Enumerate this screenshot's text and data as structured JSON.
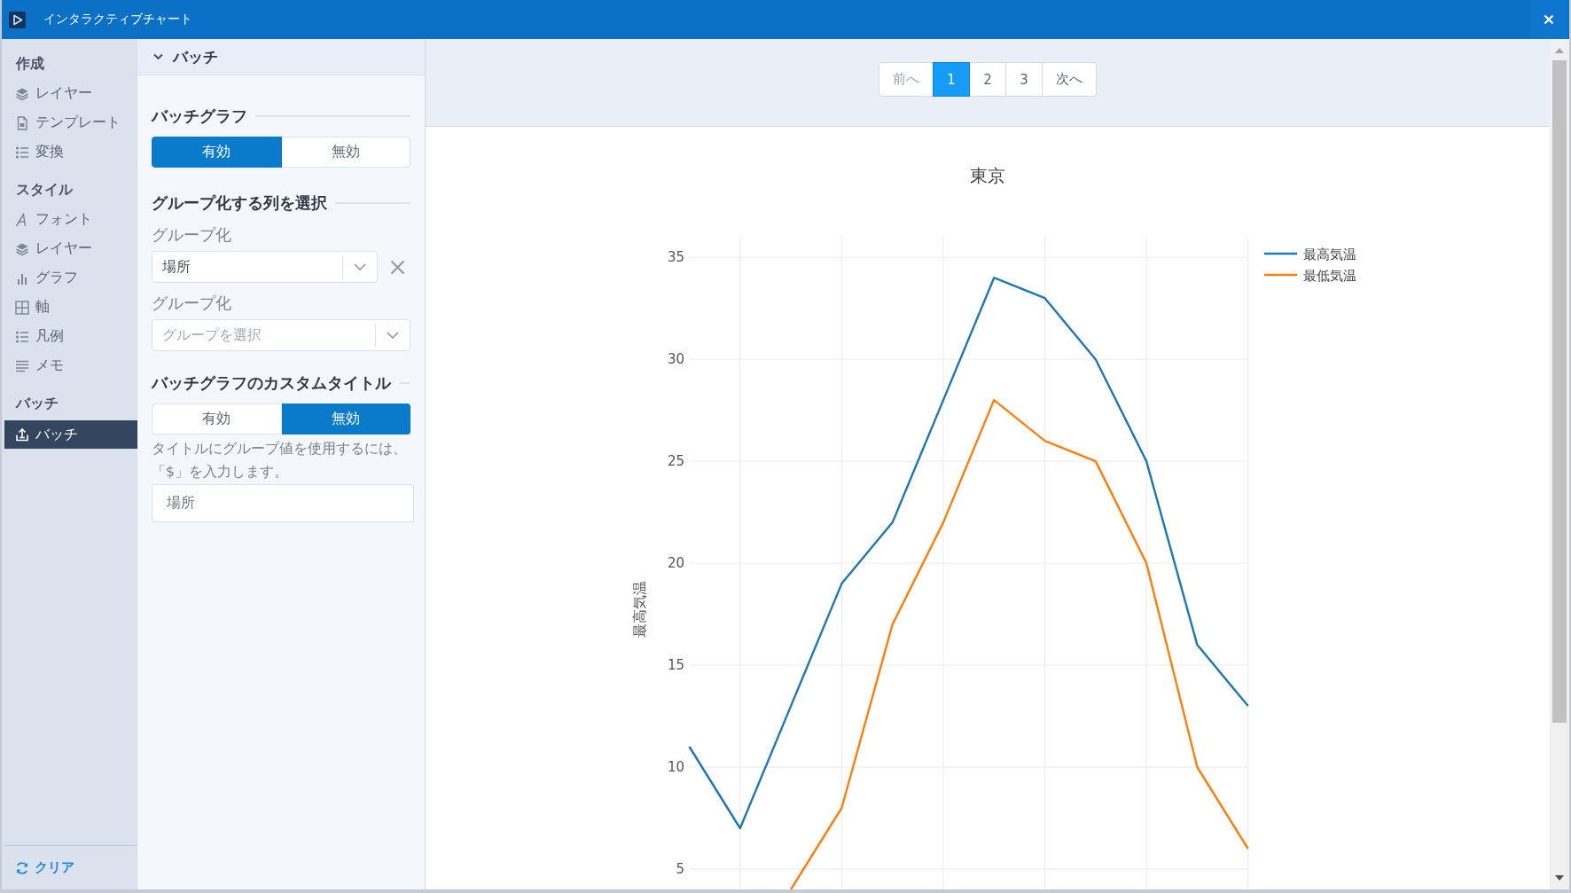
{
  "window": {
    "title": "インタラクティブチャート"
  },
  "sidebar": {
    "sections": [
      {
        "title": "作成",
        "items": [
          {
            "label": "レイヤー",
            "kind": "layer",
            "selected": false
          },
          {
            "label": "テンプレート",
            "kind": "template",
            "selected": false
          },
          {
            "label": "変換",
            "kind": "transform",
            "selected": false
          }
        ]
      },
      {
        "title": "スタイル",
        "items": [
          {
            "label": "フォント",
            "kind": "font",
            "selected": false
          },
          {
            "label": "レイヤー",
            "kind": "layer",
            "selected": false
          },
          {
            "label": "グラフ",
            "kind": "graph",
            "selected": false
          },
          {
            "label": "軸",
            "kind": "axis",
            "selected": false
          },
          {
            "label": "凡例",
            "kind": "legend",
            "selected": false
          },
          {
            "label": "メモ",
            "kind": "memo",
            "selected": false
          }
        ]
      },
      {
        "title": "バッチ",
        "items": [
          {
            "label": "バッチ",
            "kind": "batch",
            "selected": true
          }
        ]
      }
    ],
    "footer": {
      "label": "クリア"
    }
  },
  "panel": {
    "title": "バッチ",
    "expanded": true,
    "batch_graph": {
      "heading": "バッチグラフ",
      "options": [
        {
          "label": "有効",
          "selected": true
        },
        {
          "label": "無効",
          "selected": false
        }
      ]
    },
    "group_by": {
      "heading": "グループ化する列を選択",
      "fields": [
        {
          "label": "グループ化",
          "value": "場所",
          "clearable": true
        },
        {
          "label": "グループ化",
          "placeholder": "グループを選択",
          "clearable": false
        }
      ]
    },
    "custom_title": {
      "heading": "バッチグラフのカスタムタイトル",
      "options": [
        {
          "label": "有効",
          "selected": false
        },
        {
          "label": "無効",
          "selected": true
        }
      ],
      "help": "タイトルにグループ値を使用するには、「$」を入力します。",
      "value": "場所"
    }
  },
  "main": {
    "pagination": {
      "previous": {
        "label": "前へ",
        "disabled": true
      },
      "pages": [
        {
          "label": "1",
          "selected": true
        },
        {
          "label": "2",
          "selected": false
        },
        {
          "label": "3",
          "selected": false
        }
      ],
      "next": {
        "label": "次へ",
        "disabled": false
      }
    },
    "chart": {
      "chart_data": {
        "type": "line",
        "title": "東京",
        "ylabel": "最高気温",
        "ylim": [
          4,
          36
        ],
        "yticks": [
          5,
          10,
          15,
          20,
          25,
          30,
          35
        ],
        "grid": true,
        "legend": true,
        "series": [
          {
            "name": "最高気温",
            "color": "#1f77b4",
            "values": [
              11,
              7,
              13,
              19,
              22,
              28,
              34,
              33,
              30,
              25,
              16,
              13
            ]
          },
          {
            "name": "最低気温",
            "color": "#ff7f0e",
            "values": [
              null,
              null,
              4,
              8,
              17,
              22,
              28,
              26,
              25,
              20,
              10,
              6
            ]
          }
        ]
      }
    }
  }
}
